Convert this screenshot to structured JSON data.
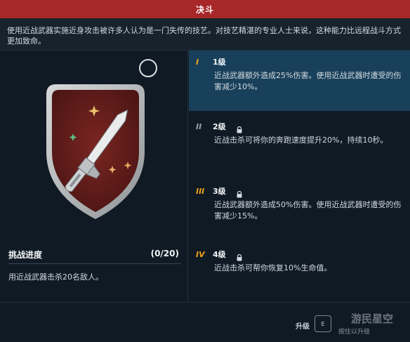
{
  "title": "决斗",
  "description": "使用近战武器实施近身攻击被许多人认为是一门失传的技艺。对技艺精湛的专业人士来说，这种能力比远程战斗方式更加致命。",
  "challenge": {
    "title": "挑战进度",
    "count": "(0/20)",
    "description": "用近战武器击杀20名敌人。",
    "progress_current": 0,
    "progress_total": 20
  },
  "levels": [
    {
      "roman": "I",
      "name": "1级",
      "locked": false,
      "active": true,
      "text": "近战武器额外造成25%伤害。使用近战武器时遭受的伤害减少10%。"
    },
    {
      "roman": "II",
      "name": "2级",
      "locked": true,
      "active": false,
      "text": "近战击杀可将你的奔跑速度提升20%，持续10秒。"
    },
    {
      "roman": "III",
      "name": "3级",
      "locked": true,
      "active": false,
      "text": "近战武器额外造成50%伤害。使用近战武器时遭受的伤害减少15%。"
    },
    {
      "roman": "IV",
      "name": "4级",
      "locked": true,
      "active": false,
      "text": "近战击杀可帮你恢复10%生命值。"
    }
  ],
  "footer": {
    "upgrade_label": "升级",
    "key": "E",
    "hold_label": "按住以升级"
  },
  "watermark": "游民星空",
  "icons": {
    "badge": "melee-blade-badge-icon",
    "lock": "lock-icon",
    "circle": "circle-toggle-icon"
  },
  "colors": {
    "title_bar": "#a8282a",
    "active_level": "#19405a",
    "rank_accent": "#f0a31b",
    "badge_fill": "#6e1f1d"
  }
}
